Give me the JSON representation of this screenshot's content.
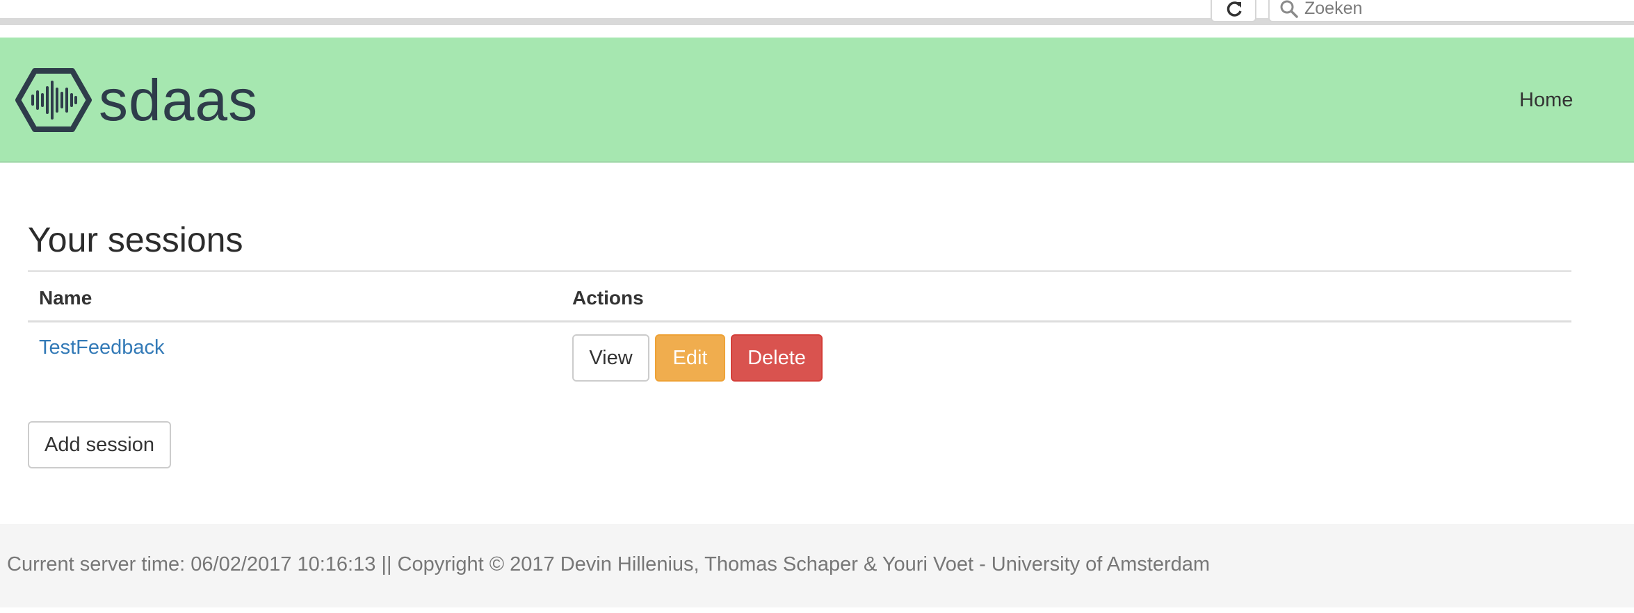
{
  "browser": {
    "search_placeholder": "Zoeken",
    "reload_icon": "reload-icon",
    "search_icon": "magnifier-icon"
  },
  "navbar": {
    "brand_name": "sdaas",
    "logo_icon": "hexagon-waveform-logo",
    "home_label": "Home",
    "background": "#a6e7b0"
  },
  "main": {
    "title": "Your sessions",
    "table": {
      "columns": [
        "Name",
        "Actions"
      ],
      "rows": [
        {
          "name": "TestFeedback",
          "actions": [
            "View",
            "Edit",
            "Delete"
          ]
        }
      ]
    },
    "add_label": "Add session"
  },
  "footer": {
    "text": "Current server time: 06/02/2017 10:16:13 || Copyright © 2017 Devin Hillenius, Thomas Schaper & Youri Voet - University of Amsterdam"
  },
  "colors": {
    "link": "#337ab7",
    "edit": "#f0ad4e",
    "delete": "#d9534f"
  }
}
